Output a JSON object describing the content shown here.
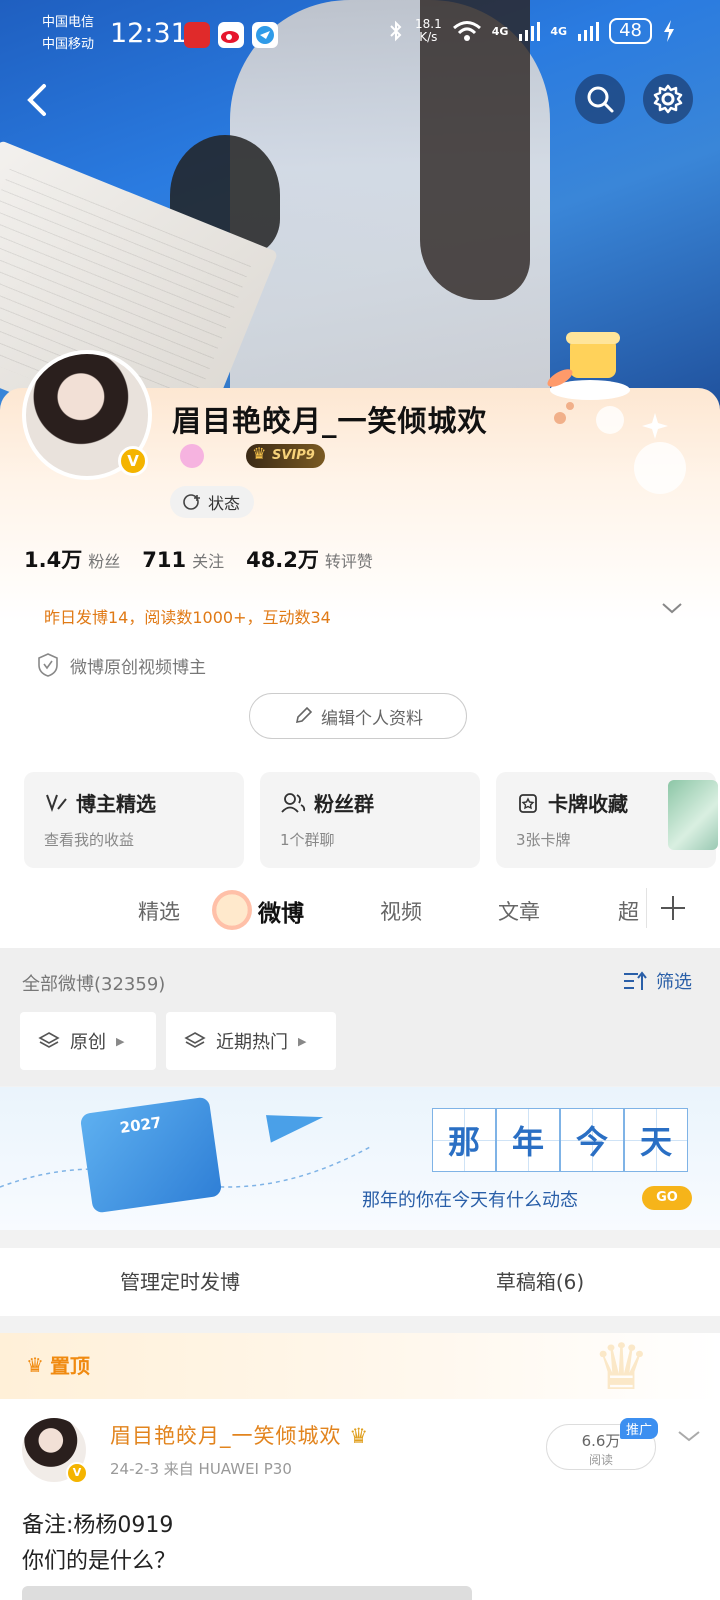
{
  "status_bar": {
    "carrier_1": "中国电信",
    "carrier_2": "中国移动",
    "time": "12:31",
    "speed_value": "18.1",
    "speed_unit": "K/s",
    "net_1": "4G",
    "net_2": "4G",
    "battery": "48"
  },
  "profile": {
    "username": "眉目艳皎月_一笑倾城欢",
    "svip": "SVIP9",
    "status_label": "状态",
    "stats": [
      {
        "num": "1.4万",
        "label": "粉丝"
      },
      {
        "num": "711",
        "label": "关注"
      },
      {
        "num": "48.2万",
        "label": "转评赞"
      }
    ],
    "yesterday": "昨日发博14，阅读数1000+，互动数34",
    "originator": "微博原创视频博主",
    "edit_label": "编辑个人资料"
  },
  "cards": [
    {
      "title": "博主精选",
      "sub": "查看我的收益"
    },
    {
      "title": "粉丝群",
      "sub": "1个群聊"
    },
    {
      "title": "卡牌收藏",
      "sub": "3张卡牌"
    }
  ],
  "tabs": [
    "精选",
    "微博",
    "视频",
    "文章",
    "超"
  ],
  "filter": {
    "all_label": "全部微博(32359)",
    "filter_label": "筛选",
    "chip_1": "原创",
    "chip_2": "近期热门"
  },
  "banner": {
    "chars": [
      "那",
      "年",
      "今",
      "天"
    ],
    "calendar_year": "2027",
    "subtitle": "那年的你在今天有什么动态",
    "go": "GO"
  },
  "manage": {
    "scheduled": "管理定时发博",
    "drafts": "草稿箱(6)"
  },
  "pinned": {
    "label": "置顶",
    "name": "眉目艳皎月_一笑倾城欢",
    "meta": "24-2-3  来自 HUAWEI P30",
    "read_num": "6.6万",
    "read_label": "阅读",
    "promo": "推广",
    "text_1": "备注:杨杨0919",
    "text_2": "你们的是什么？"
  }
}
